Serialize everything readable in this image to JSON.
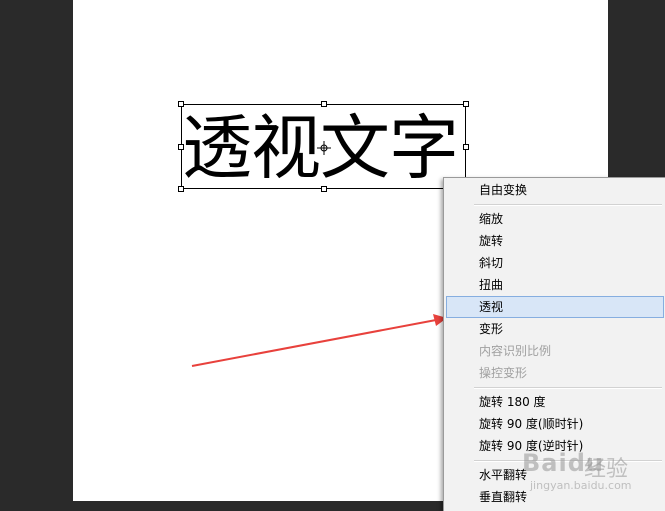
{
  "canvas": {
    "layer_text": "透视文字"
  },
  "context_menu": {
    "items": [
      {
        "label": "自由变换",
        "state": "enabled"
      },
      {
        "label": "缩放",
        "state": "enabled"
      },
      {
        "label": "旋转",
        "state": "enabled"
      },
      {
        "label": "斜切",
        "state": "enabled"
      },
      {
        "label": "扭曲",
        "state": "enabled"
      },
      {
        "label": "透视",
        "state": "highlighted"
      },
      {
        "label": "变形",
        "state": "enabled"
      },
      {
        "label": "内容识别比例",
        "state": "disabled"
      },
      {
        "label": "操控变形",
        "state": "disabled"
      },
      {
        "label": "旋转 180 度",
        "state": "enabled"
      },
      {
        "label": "旋转 90 度(顺时针)",
        "state": "enabled"
      },
      {
        "label": "旋转 90 度(逆时针)",
        "state": "enabled"
      },
      {
        "label": "水平翻转",
        "state": "enabled"
      },
      {
        "label": "垂直翻转",
        "state": "enabled"
      }
    ]
  },
  "watermark": {
    "logo": "Baidu",
    "text": "经验",
    "url": "jingyan.baidu.com"
  },
  "colors": {
    "workspace_bg": "#2a2a2a",
    "canvas_bg": "#ffffff",
    "menu_bg": "#f2f2f2",
    "menu_highlight": "#d8e6f7",
    "menu_highlight_border": "#86aee0",
    "disabled_text": "#a0a0a0",
    "annotation_arrow": "#e8413c"
  },
  "icons": {
    "pivot": "crosshair-icon",
    "annotation": "red-arrow-icon"
  }
}
